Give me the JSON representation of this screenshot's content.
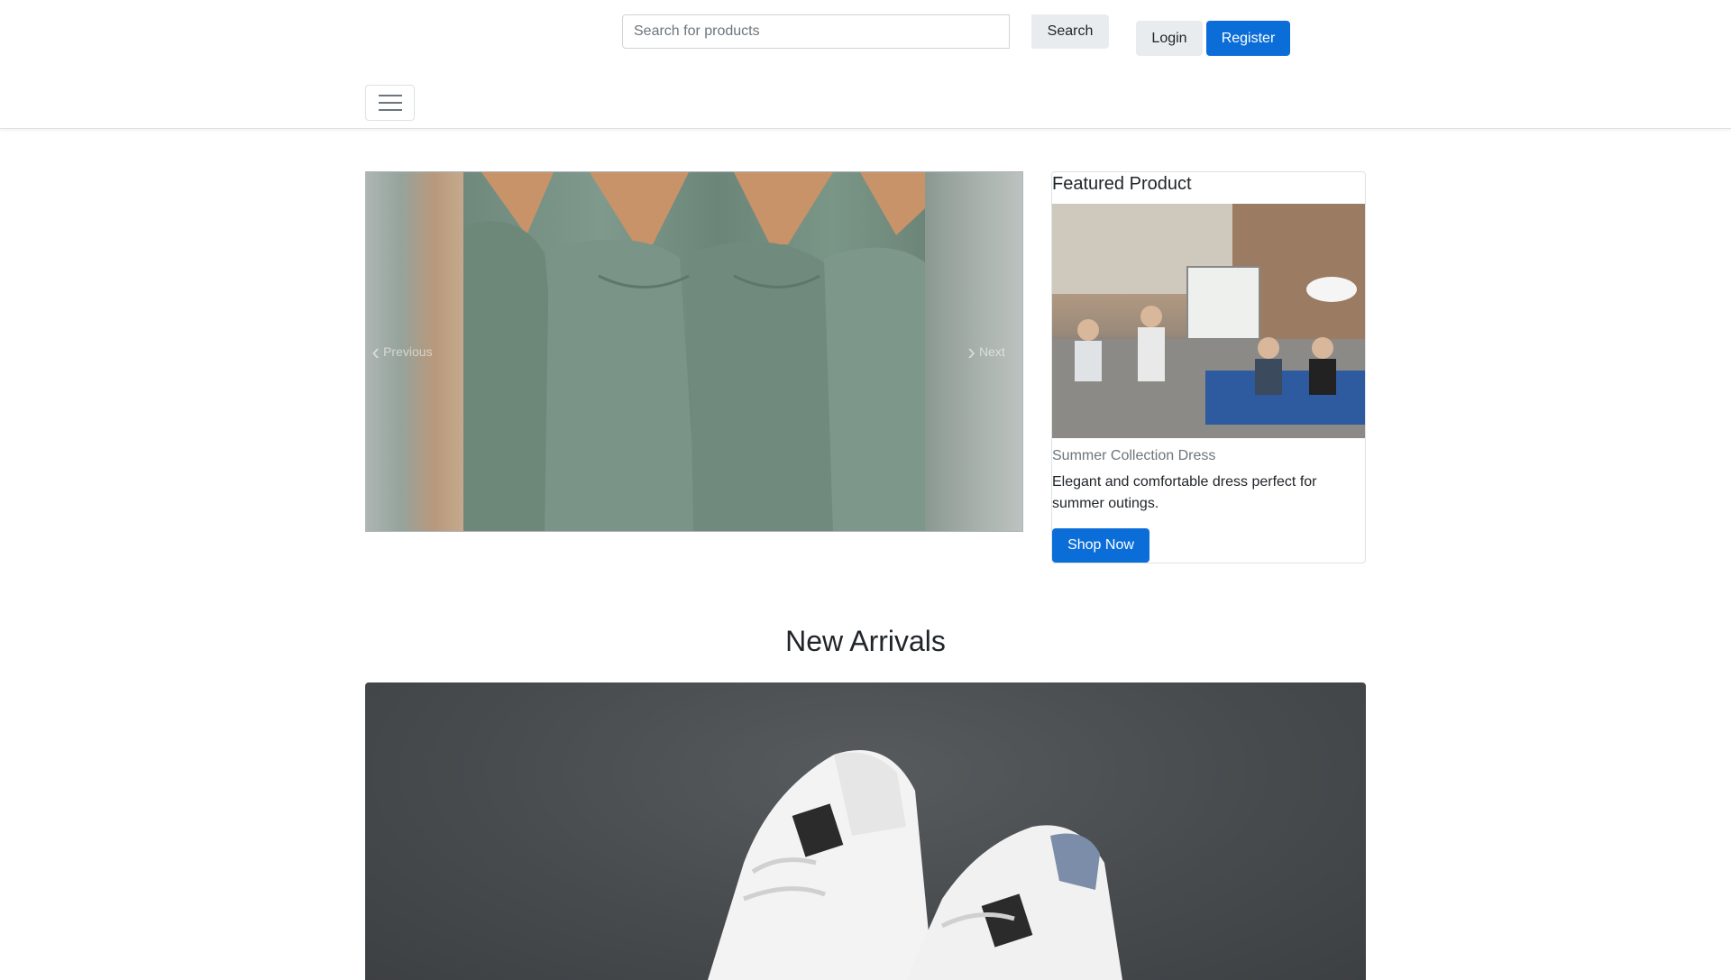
{
  "header": {
    "search_placeholder": "Search for products",
    "search_label": "Search",
    "login_label": "Login",
    "register_label": "Register"
  },
  "carousel": {
    "prev_label": "Previous",
    "next_label": "Next"
  },
  "featured": {
    "heading": "Featured Product",
    "product_name": "Summer Collection Dress",
    "description": "Elegant and comfortable dress perfect for summer outings.",
    "cta_label": "Shop Now"
  },
  "arrivals": {
    "heading": "New Arrivals"
  },
  "colors": {
    "primary": "#0b6ed8",
    "secondary": "#e9ecef"
  }
}
